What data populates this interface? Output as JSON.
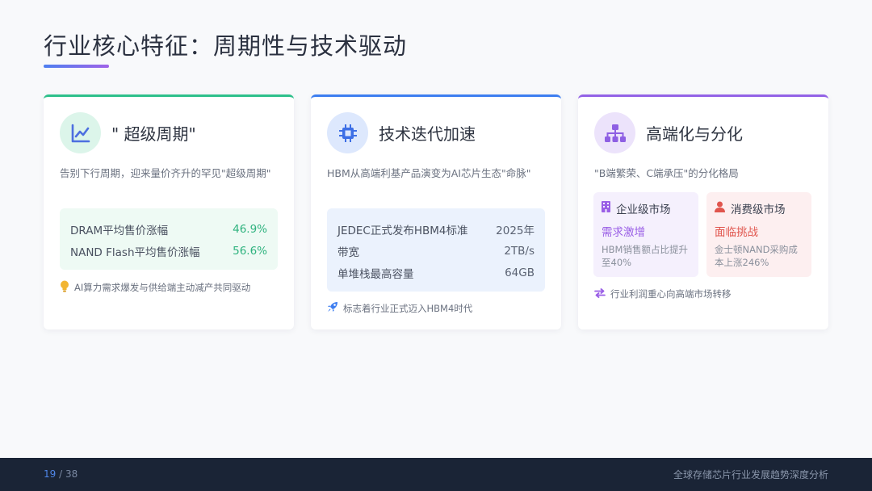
{
  "title": "行业核心特征：周期性与技术驱动",
  "colors": {
    "accent_green": "#2ec08b",
    "accent_blue": "#3d7ef0",
    "accent_purple": "#9362e6",
    "footer_bg": "#1a2436"
  },
  "cards": [
    {
      "icon": "line-chart-icon",
      "title": "\" 超级周期\"",
      "desc": "告别下行周期，迎来量价齐升的罕见\"超级周期\"",
      "metrics": [
        {
          "label": "DRAM平均售价涨幅",
          "value": "46.9%"
        },
        {
          "label": "NAND Flash平均售价涨幅",
          "value": "56.6%"
        }
      ],
      "note_icon": "lightbulb-icon",
      "note": "AI算力需求爆发与供给端主动减产共同驱动"
    },
    {
      "icon": "chip-icon",
      "title": "技术迭代加速",
      "desc": "HBM从高端利基产品演变为AI芯片生态\"命脉\"",
      "metrics": [
        {
          "label": "JEDEC正式发布HBM4标准",
          "value": "2025年"
        },
        {
          "label": "带宽",
          "value": "2TB/s"
        },
        {
          "label": "单堆栈最高容量",
          "value": "64GB"
        }
      ],
      "note_icon": "rocket-icon",
      "note": "标志着行业正式迈入HBM4时代"
    },
    {
      "icon": "hierarchy-icon",
      "title": "高端化与分化",
      "desc": "\"B端繁荣、C端承压\"的分化格局",
      "markets": [
        {
          "icon": "building-icon",
          "name": "企业级市场",
          "status": "需求激增",
          "text": "HBM销售额占比提升至40%"
        },
        {
          "icon": "user-icon",
          "name": "消费级市场",
          "status": "面临挑战",
          "text": "金士顿NAND采购成本上涨246%"
        }
      ],
      "note_icon": "swap-arrows-icon",
      "note": "行业利润重心向高端市场转移"
    }
  ],
  "footer": {
    "page_current": "19",
    "page_sep": " / ",
    "page_total": "38",
    "text": "全球存储芯片行业发展趋势深度分析"
  }
}
